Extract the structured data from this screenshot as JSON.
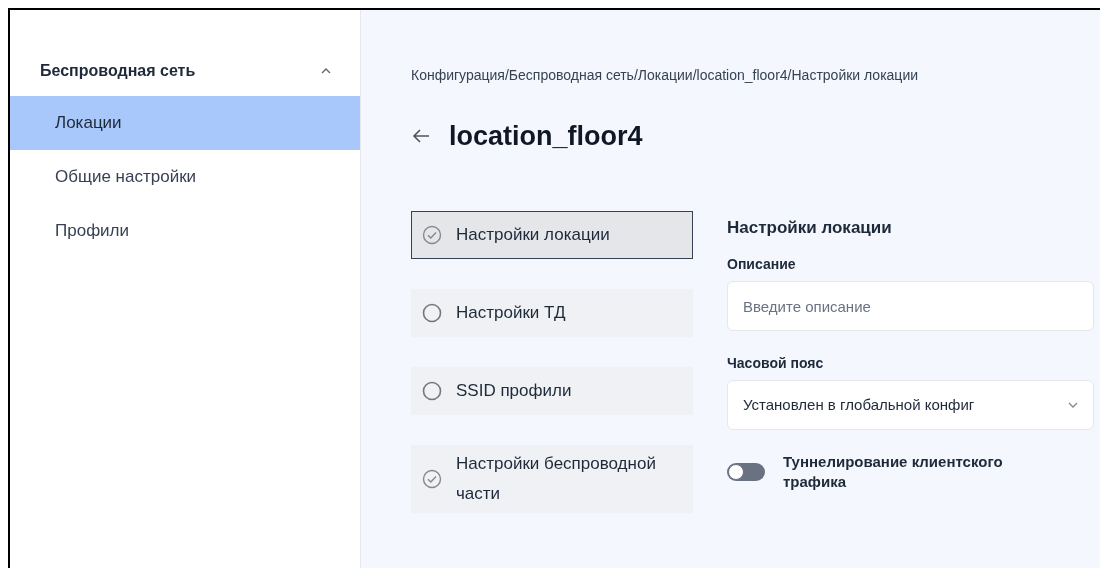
{
  "sidebar": {
    "section": {
      "label": "Беспроводная сеть",
      "expanded": true
    },
    "items": [
      {
        "label": "Локации",
        "selected": true
      },
      {
        "label": "Общие настройки",
        "selected": false
      },
      {
        "label": "Профили",
        "selected": false
      }
    ]
  },
  "breadcrumb": "Конфигурация/Беспроводная сеть/Локации/location_floor4/Настройки локации",
  "page_title": "location_floor4",
  "steps": [
    {
      "label": "Настройки локации",
      "selected": true,
      "completed": true
    },
    {
      "label": "Настройки ТД",
      "selected": false,
      "completed": false
    },
    {
      "label": "SSID профили",
      "selected": false,
      "completed": false
    },
    {
      "label": "Настройки беспроводной части",
      "selected": false,
      "completed": true
    }
  ],
  "form": {
    "title": "Настройки локации",
    "description": {
      "label": "Описание",
      "placeholder": "Введите описание"
    },
    "timezone": {
      "label": "Часовой пояс",
      "value": "Установлен в глобальной конфиг"
    },
    "tunneling": {
      "label": "Туннелирование клиентского трафика",
      "on": false
    }
  }
}
